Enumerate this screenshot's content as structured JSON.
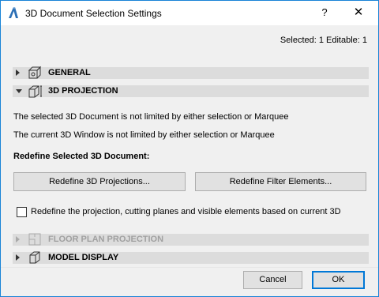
{
  "window": {
    "title": "3D Document Selection Settings",
    "help_label": "?",
    "close_label": "✕"
  },
  "status": {
    "selected_text": "Selected: 1 Editable: 1"
  },
  "sections": {
    "general": {
      "label": "GENERAL",
      "expanded": false
    },
    "projection": {
      "label": "3D PROJECTION",
      "expanded": true
    },
    "floor_plan": {
      "label": "FLOOR PLAN PROJECTION",
      "expanded": false,
      "disabled": true
    },
    "model_display": {
      "label": "MODEL DISPLAY",
      "expanded": false
    }
  },
  "projection": {
    "info_line_1": "The selected 3D Document is not limited by either selection or Marquee",
    "info_line_2": "The current 3D Window is not limited by either selection or Marquee",
    "redefine_heading": "Redefine Selected 3D Document:",
    "redefine_projections_label": "Redefine 3D Projections...",
    "redefine_filter_label": "Redefine Filter Elements...",
    "checkbox_label": "Redefine the projection, cutting planes and visible elements based on current 3D",
    "checkbox_checked": false
  },
  "footer": {
    "cancel_label": "Cancel",
    "ok_label": "OK"
  },
  "colors": {
    "accent": "#0078d7",
    "section_bg": "#dcdcdc",
    "dialog_bg": "#f0f0f0"
  }
}
